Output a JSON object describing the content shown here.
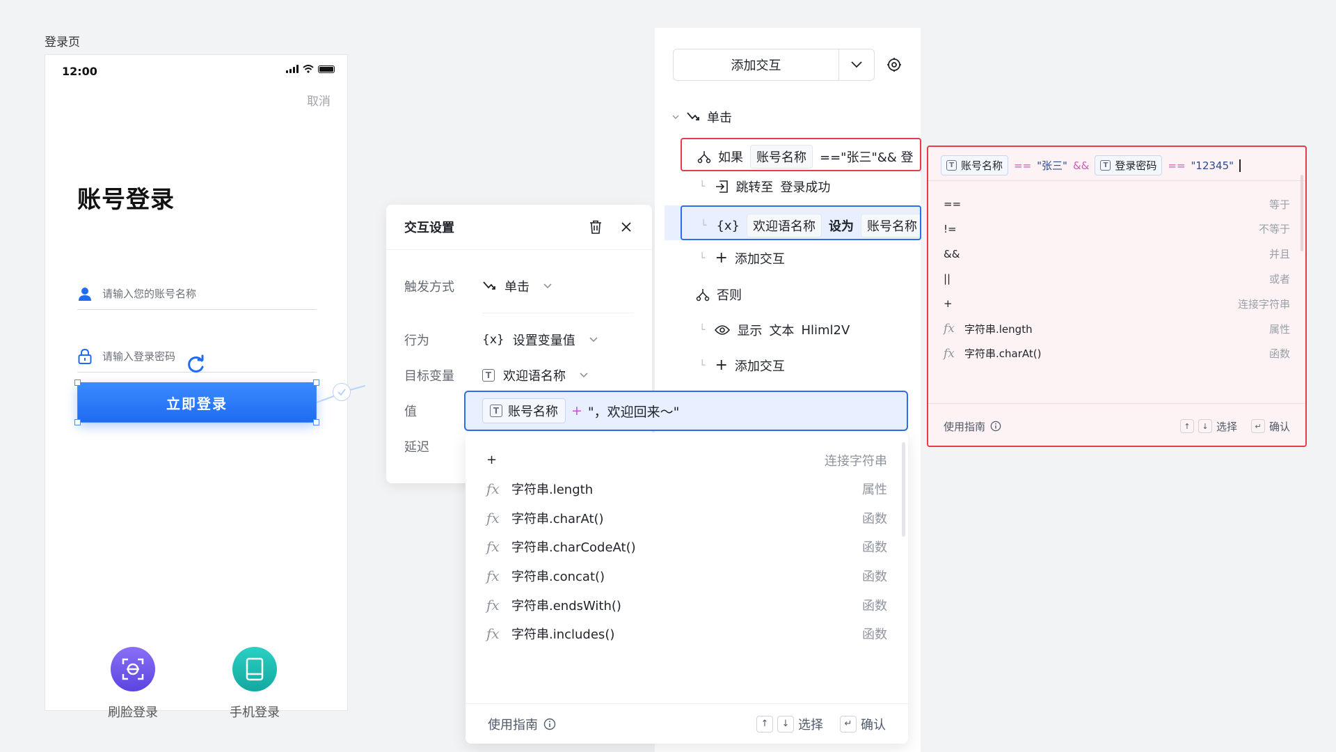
{
  "canvas": {
    "page_label": "登录页"
  },
  "phone": {
    "status_time": "12:00",
    "cancel": "取消",
    "title": "账号登录",
    "account_placeholder": "请输入您的账号名称",
    "password_placeholder": "请输入登录密码",
    "login_button": "立即登录",
    "face_login": "刷脸登录",
    "phone_login": "手机登录",
    "colors": {
      "primary": "#1f6bf2",
      "face": "#6b57e8",
      "phone": "#17b8b0"
    }
  },
  "settings": {
    "title": "交互设置",
    "trigger_label": "触发方式",
    "trigger_value": "单击",
    "action_label": "行为",
    "action_value": "设置变量值",
    "target_label": "目标变量",
    "target_value": "欢迎语名称",
    "value_label": "值",
    "delay_label": "延迟"
  },
  "value_expression": {
    "chip": "账号名称",
    "op": "+",
    "literal": "\"，欢迎回来～\""
  },
  "value_dropdown": {
    "items": [
      {
        "icon": "",
        "name": "+",
        "kind": "连接字符串"
      },
      {
        "icon": "fx",
        "name": "字符串.length",
        "kind": "属性"
      },
      {
        "icon": "fx",
        "name": "字符串.charAt()",
        "kind": "函数"
      },
      {
        "icon": "fx",
        "name": "字符串.charCodeAt()",
        "kind": "函数"
      },
      {
        "icon": "fx",
        "name": "字符串.concat()",
        "kind": "函数"
      },
      {
        "icon": "fx",
        "name": "字符串.endsWith()",
        "kind": "函数"
      },
      {
        "icon": "fx",
        "name": "字符串.includes()",
        "kind": "函数"
      }
    ],
    "footer_guide": "使用指南",
    "footer_select": "选择",
    "footer_confirm": "确认"
  },
  "tree": {
    "add_button": "添加交互",
    "trigger": "单击",
    "if_label": "如果",
    "if_chip": "账号名称",
    "if_expr": "==\"张三\"&& 登",
    "goto_label": "跳转至",
    "goto_target": "登录成功",
    "var_icon": "{x}",
    "set_var": "欢迎语名称",
    "set_to": "设为",
    "set_value": "账号名称",
    "add_interaction": "添加交互",
    "else_label": "否则",
    "show_label": "显示",
    "show_type": "文本",
    "show_target": "Hliml2V",
    "add_interaction_2": "添加交互"
  },
  "condition": {
    "chip1": "账号名称",
    "op1": "==",
    "lit1": "\"张三\"",
    "op2": "&&",
    "chip2": "登录密码",
    "op3": "==",
    "lit2": "\"12345\"",
    "items": [
      {
        "icon": "",
        "name": "==",
        "kind": "等于"
      },
      {
        "icon": "",
        "name": "!=",
        "kind": "不等于"
      },
      {
        "icon": "",
        "name": "&&",
        "kind": "并且"
      },
      {
        "icon": "",
        "name": "||",
        "kind": "或者"
      },
      {
        "icon": "",
        "name": "+",
        "kind": "连接字符串"
      },
      {
        "icon": "fx",
        "name": "字符串.length",
        "kind": "属性"
      },
      {
        "icon": "fx",
        "name": "字符串.charAt()",
        "kind": "函数"
      }
    ],
    "footer_guide": "使用指南",
    "footer_select": "选择",
    "footer_confirm": "确认"
  }
}
